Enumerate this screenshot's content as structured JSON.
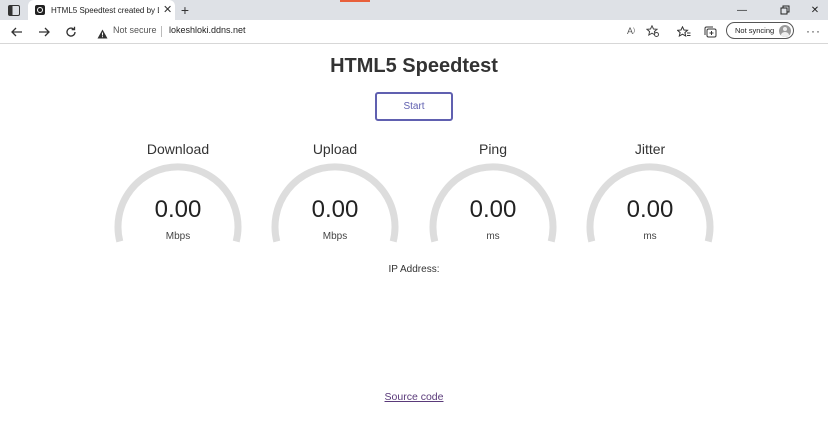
{
  "browser": {
    "tab_title": "HTML5 Speedtest created by Lol",
    "security_label": "Not secure",
    "url": "lokeshloki.ddns.net",
    "sync_label": "Not syncing"
  },
  "page": {
    "title": "HTML5 Speedtest",
    "start_label": "Start",
    "gauges": [
      {
        "label": "Download",
        "value": "0.00",
        "unit": "Mbps"
      },
      {
        "label": "Upload",
        "value": "0.00",
        "unit": "Mbps"
      },
      {
        "label": "Ping",
        "value": "0.00",
        "unit": "ms"
      },
      {
        "label": "Jitter",
        "value": "0.00",
        "unit": "ms"
      }
    ],
    "ip_label": "IP Address:",
    "source_label": "Source code"
  },
  "colors": {
    "accent": "#6060b0",
    "gauge_track": "#dddddd",
    "tab_strip": "#dee1e6"
  }
}
